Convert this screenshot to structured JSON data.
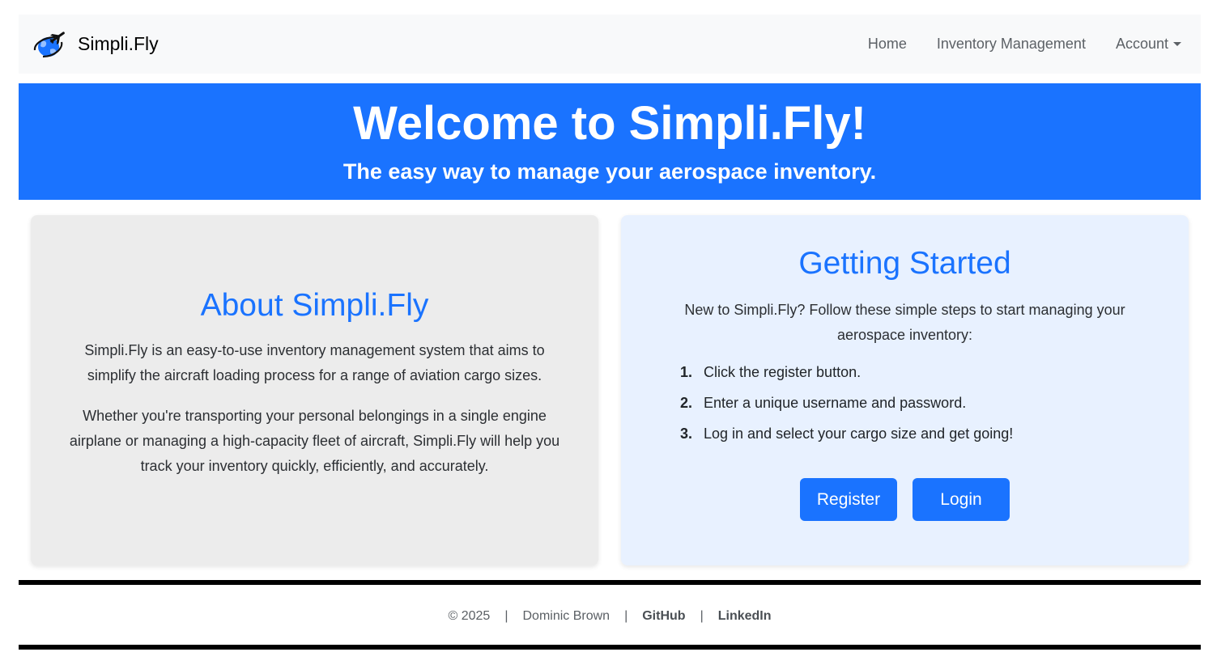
{
  "navbar": {
    "brand": "Simpli.Fly",
    "links": {
      "home": "Home",
      "inventory": "Inventory Management",
      "account": "Account"
    }
  },
  "hero": {
    "title": "Welcome to Simpli.Fly!",
    "subtitle": "The easy way to manage your aerospace inventory."
  },
  "about": {
    "title": "About Simpli.Fly",
    "paragraph1": "Simpli.Fly is an easy-to-use inventory management system that aims to simplify the aircraft loading process for a range of aviation cargo sizes.",
    "paragraph2": "Whether you're transporting your personal belongings in a single engine airplane or managing a high-capacity fleet of aircraft, Simpli.Fly will help you track your inventory quickly, efficiently, and accurately."
  },
  "getting_started": {
    "title": "Getting Started",
    "intro": "New to Simpli.Fly? Follow these simple steps to start managing your aerospace inventory:",
    "steps": [
      {
        "num": "1.",
        "text": "Click the register button."
      },
      {
        "num": "2.",
        "text": "Enter a unique username and password."
      },
      {
        "num": "3.",
        "text": "Log in and select your cargo size and get going!"
      }
    ],
    "register_label": "Register",
    "login_label": "Login"
  },
  "footer": {
    "copyright": "© 2025",
    "author": "Dominic Brown",
    "github": "GitHub",
    "linkedin": "LinkedIn",
    "separator": "|"
  },
  "colors": {
    "accent": "#1a73ff",
    "navbar_bg": "#f8f9fa",
    "about_bg": "#ececec",
    "start_bg": "#e8f1ff"
  },
  "icons": {
    "brand_logo": "globe-airplane-icon"
  }
}
